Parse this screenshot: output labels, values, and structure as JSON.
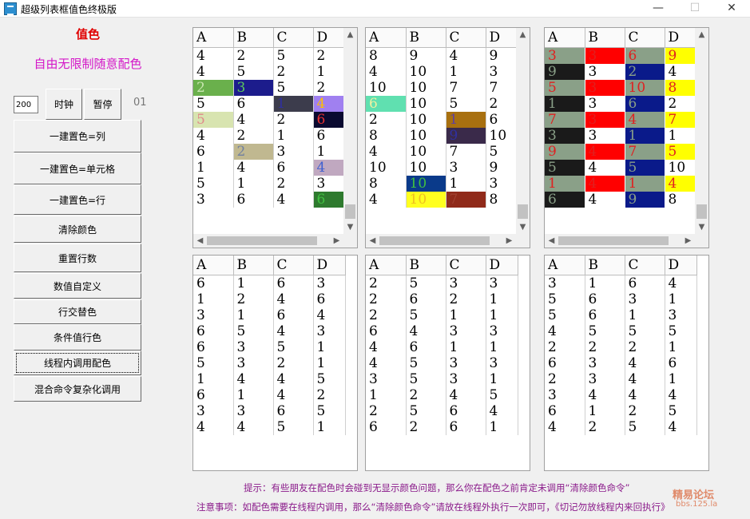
{
  "window": {
    "title": "超级列表框值色终极版",
    "minimize_glyph": "—",
    "maximize_glyph": "☐",
    "close_glyph": "✕"
  },
  "left_panel": {
    "value_color_label": "值色",
    "free_color_label": "自由无限制随意配色",
    "interval_value": "200",
    "clock_button": "时钟",
    "pause_button": "暂停",
    "counter": "01",
    "buttons": [
      "一建置色=列",
      "一建置色=单元格",
      "一建置色=行",
      "清除颜色",
      "重置行数",
      "数值自定义",
      "行交替色",
      "条件值行色",
      "线程内调用配色",
      "混合命令复杂化调用"
    ]
  },
  "grids": [
    {
      "headers": [
        "A",
        "B",
        "C",
        "D"
      ],
      "rows": [
        [
          "4",
          "2",
          "5",
          "2"
        ],
        [
          "4",
          "5",
          "2",
          "1"
        ],
        [
          "2",
          "3",
          "5",
          "2"
        ],
        [
          "5",
          "6",
          "1",
          "4"
        ],
        [
          "5",
          "4",
          "2",
          "6"
        ],
        [
          "4",
          "2",
          "1",
          "6"
        ],
        [
          "6",
          "2",
          "3",
          "1"
        ],
        [
          "1",
          "4",
          "6",
          "4"
        ],
        [
          "5",
          "1",
          "2",
          "3"
        ],
        [
          "3",
          "6",
          "4",
          "6"
        ]
      ],
      "cell_colors": [
        {
          "row": 2,
          "col": 0,
          "bg": "#6ab04c",
          "fg": "#c8e6b0"
        },
        {
          "row": 2,
          "col": 1,
          "bg": "#1c1c8c",
          "fg": "#5cc85c"
        },
        {
          "row": 3,
          "col": 2,
          "bg": "#3c3c4c",
          "fg": "#3030a0"
        },
        {
          "row": 3,
          "col": 3,
          "bg": "#a080f0",
          "fg": "#ffc000"
        },
        {
          "row": 4,
          "col": 0,
          "bg": "#d8e4b0",
          "fg": "#e08a8a"
        },
        {
          "row": 4,
          "col": 3,
          "bg": "#0a0a30",
          "fg": "#e83030"
        },
        {
          "row": 6,
          "col": 1,
          "bg": "#c0b890",
          "fg": "#7080a0"
        },
        {
          "row": 7,
          "col": 3,
          "bg": "#c0a8c0",
          "fg": "#4060d0"
        },
        {
          "row": 9,
          "col": 3,
          "bg": "#2e7a2e",
          "fg": "#40c040"
        }
      ]
    },
    {
      "headers": [
        "A",
        "B",
        "C",
        "D"
      ],
      "rows": [
        [
          "8",
          "9",
          "4",
          "9"
        ],
        [
          "4",
          "10",
          "1",
          "3"
        ],
        [
          "10",
          "10",
          "7",
          "7"
        ],
        [
          "6",
          "10",
          "5",
          "2"
        ],
        [
          "2",
          "10",
          "1",
          "6"
        ],
        [
          "8",
          "10",
          "9",
          "10"
        ],
        [
          "4",
          "10",
          "7",
          "5"
        ],
        [
          "10",
          "10",
          "3",
          "9"
        ],
        [
          "8",
          "10",
          "1",
          "3"
        ],
        [
          "4",
          "10",
          "7",
          "8"
        ]
      ],
      "cell_colors": [
        {
          "row": 3,
          "col": 0,
          "bg": "#60e0b0",
          "fg": "#f0f0a0"
        },
        {
          "row": 4,
          "col": 2,
          "bg": "#a87010",
          "fg": "#6040a0"
        },
        {
          "row": 5,
          "col": 2,
          "bg": "#3a2a4a",
          "fg": "#3030a0"
        },
        {
          "row": 8,
          "col": 1,
          "bg": "#0a3a8a",
          "fg": "#40c040"
        },
        {
          "row": 9,
          "col": 1,
          "bg": "#ffff20",
          "fg": "#f0c020"
        },
        {
          "row": 9,
          "col": 2,
          "bg": "#902a1a",
          "fg": "#a04030"
        }
      ]
    },
    {
      "headers": [
        "A",
        "B",
        "C",
        "D"
      ],
      "rows": [
        [
          "3",
          "3",
          "6",
          "9"
        ],
        [
          "9",
          "3",
          "2",
          "4"
        ],
        [
          "5",
          "3",
          "10",
          "8"
        ],
        [
          "1",
          "3",
          "6",
          "2"
        ],
        [
          "7",
          "3",
          "4",
          "7"
        ],
        [
          "3",
          "3",
          "1",
          "1"
        ],
        [
          "9",
          "4",
          "7",
          "5"
        ],
        [
          "5",
          "4",
          "5",
          "10"
        ],
        [
          "1",
          "4",
          "1",
          "4"
        ],
        [
          "6",
          "4",
          "9",
          "8"
        ]
      ],
      "row_style": "alternating",
      "col_colors_even": [
        {
          "bg": "#8aa088",
          "fg": "#e02020"
        },
        {
          "bg": "#ff0000",
          "fg": "#e02020"
        },
        {
          "bg": "#8aa088",
          "fg": "#e02020"
        },
        {
          "bg": "#ffff00",
          "fg": "#e02020"
        }
      ],
      "col_colors_odd": [
        {
          "bg": "#1a1a1a",
          "fg": "#8aa088"
        },
        {
          "bg": "#ffffff",
          "fg": "#000000"
        },
        {
          "bg": "#0a1a8a",
          "fg": "#8aa088"
        },
        {
          "bg": "#ffffff",
          "fg": "#000000"
        }
      ]
    },
    {
      "headers": [
        "A",
        "B",
        "C",
        "D"
      ],
      "rows": [
        [
          "6",
          "1",
          "6",
          "3"
        ],
        [
          "1",
          "2",
          "4",
          "6"
        ],
        [
          "3",
          "1",
          "6",
          "4"
        ],
        [
          "6",
          "5",
          "4",
          "3"
        ],
        [
          "6",
          "3",
          "5",
          "1"
        ],
        [
          "5",
          "3",
          "2",
          "1"
        ],
        [
          "1",
          "4",
          "4",
          "5"
        ],
        [
          "6",
          "1",
          "4",
          "2"
        ],
        [
          "3",
          "3",
          "6",
          "5"
        ],
        [
          "4",
          "4",
          "5",
          "1"
        ]
      ]
    },
    {
      "headers": [
        "A",
        "B",
        "C",
        "D"
      ],
      "rows": [
        [
          "2",
          "5",
          "3",
          "3"
        ],
        [
          "2",
          "6",
          "2",
          "1"
        ],
        [
          "2",
          "5",
          "1",
          "1"
        ],
        [
          "6",
          "4",
          "3",
          "3"
        ],
        [
          "4",
          "6",
          "1",
          "1"
        ],
        [
          "4",
          "5",
          "3",
          "3"
        ],
        [
          "3",
          "5",
          "3",
          "1"
        ],
        [
          "1",
          "2",
          "4",
          "5"
        ],
        [
          "2",
          "5",
          "6",
          "4"
        ],
        [
          "6",
          "2",
          "6",
          "1"
        ]
      ]
    },
    {
      "headers": [
        "A",
        "B",
        "C",
        "D"
      ],
      "rows": [
        [
          "3",
          "1",
          "6",
          "4"
        ],
        [
          "5",
          "6",
          "3",
          "1"
        ],
        [
          "5",
          "6",
          "1",
          "3"
        ],
        [
          "4",
          "5",
          "5",
          "5"
        ],
        [
          "2",
          "2",
          "2",
          "1"
        ],
        [
          "6",
          "3",
          "4",
          "6"
        ],
        [
          "2",
          "3",
          "4",
          "1"
        ],
        [
          "3",
          "4",
          "4",
          "4"
        ],
        [
          "6",
          "1",
          "2",
          "5"
        ],
        [
          "4",
          "2",
          "5",
          "4"
        ]
      ]
    }
  ],
  "footer": {
    "tip": "提示：有些朋友在配色时会碰到无显示颜色问题，那么你在配色之前肯定未调用“清除颜色命令”",
    "note": "注意事项：如配色需要在线程内调用，那么“清除颜色命令”请放在线程外执行一次即可，《切记勿放线程内来回执行》"
  },
  "watermark": {
    "name": "精易论坛",
    "url": "bbs.125.la"
  }
}
